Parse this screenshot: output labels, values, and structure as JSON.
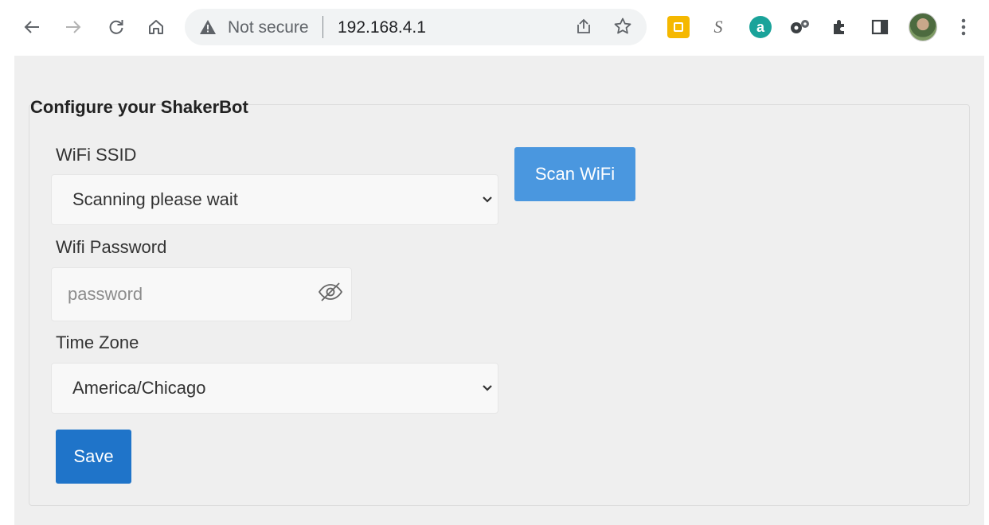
{
  "browser": {
    "security_label": "Not secure",
    "url": "192.168.4.1",
    "extension_s": "S",
    "extension_a": "a"
  },
  "form": {
    "title": "Configure your ShakerBot",
    "ssid_label": "WiFi SSID",
    "ssid_value": "Scanning please wait",
    "scan_button": "Scan WiFi",
    "password_label": "Wifi Password",
    "password_placeholder": "password",
    "timezone_label": "Time Zone",
    "timezone_value": "America/Chicago",
    "save_button": "Save"
  },
  "colors": {
    "scan_button": "#4a97df",
    "save_button": "#1f74c9",
    "page_background": "#efefef"
  }
}
